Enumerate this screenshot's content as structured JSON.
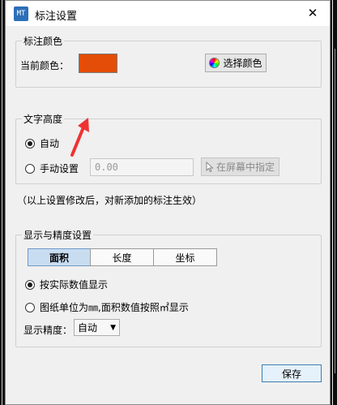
{
  "window": {
    "title": "标注设置",
    "icon_text": "MT",
    "close_glyph": "✕"
  },
  "color_section": {
    "group_label": "标注颜色",
    "current_label": "当前颜色：",
    "current_color": "#e34d08",
    "choose_button": "选择颜色"
  },
  "height_section": {
    "group_label": "文字高度",
    "auto_label": "自动",
    "manual_label": "手动设置",
    "auto_selected": true,
    "height_value": "0.00",
    "pick_button": "在屏幕中指定"
  },
  "note": "（以上设置修改后，对新添加的标注生效）",
  "display_section": {
    "group_label": "显示与精度设置",
    "tabs": [
      "面积",
      "长度",
      "坐标"
    ],
    "active_tab": "面积",
    "option_actual": "按实际数值显示",
    "option_unit": "图纸单位为㎜,面积数值按照㎡显示",
    "actual_selected": true,
    "precision_label": "显示精度：",
    "precision_value": "自动"
  },
  "footer": {
    "save_button": "保存"
  }
}
